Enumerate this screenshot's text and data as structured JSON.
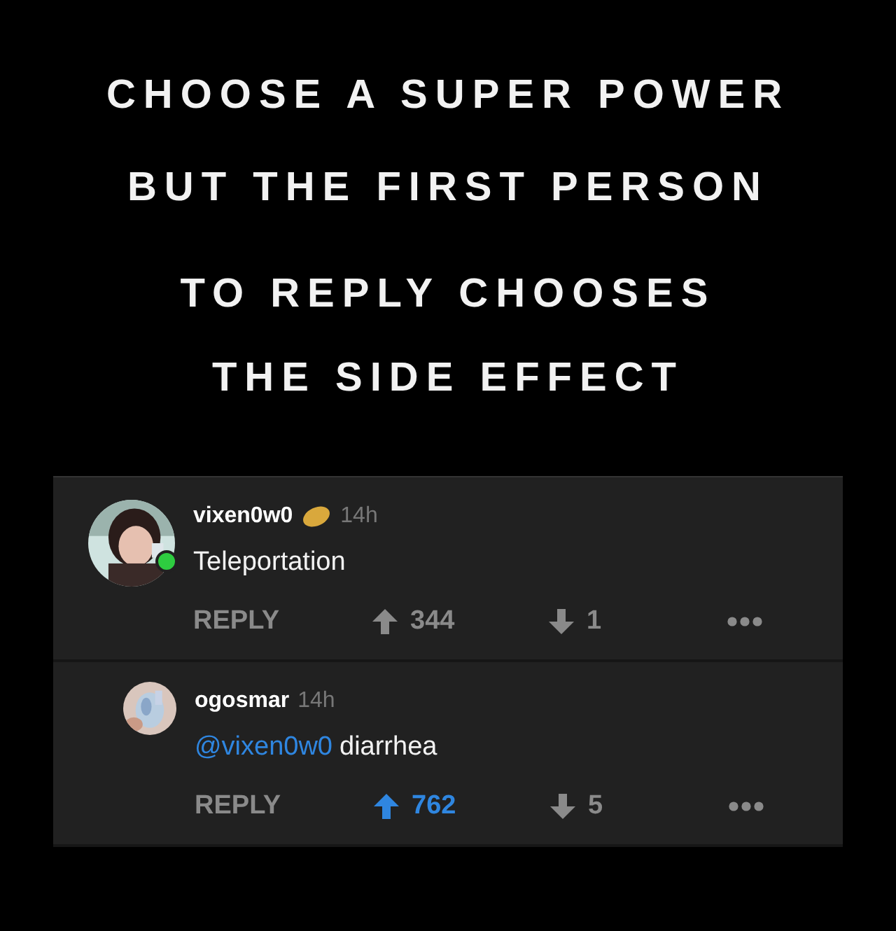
{
  "headline": [
    "CHOOSE A SUPER POWER",
    "BUT THE FIRST PERSON",
    "TO REPLY CHOOSES",
    "THE SIDE EFFECT"
  ],
  "comments": [
    {
      "kind": "top",
      "author": "vixen0w0",
      "badge": true,
      "online": true,
      "time": "14h",
      "text": "Teleportation",
      "reply_label": "REPLY",
      "upvotes": "344",
      "downvotes": "1",
      "upvoted": false
    },
    {
      "kind": "reply",
      "author": "ogosmar",
      "badge": false,
      "online": false,
      "time": "14h",
      "mention": "@vixen0w0",
      "text": "diarrhea",
      "reply_label": "REPLY",
      "upvotes": "762",
      "downvotes": "5",
      "upvoted": true
    }
  ]
}
